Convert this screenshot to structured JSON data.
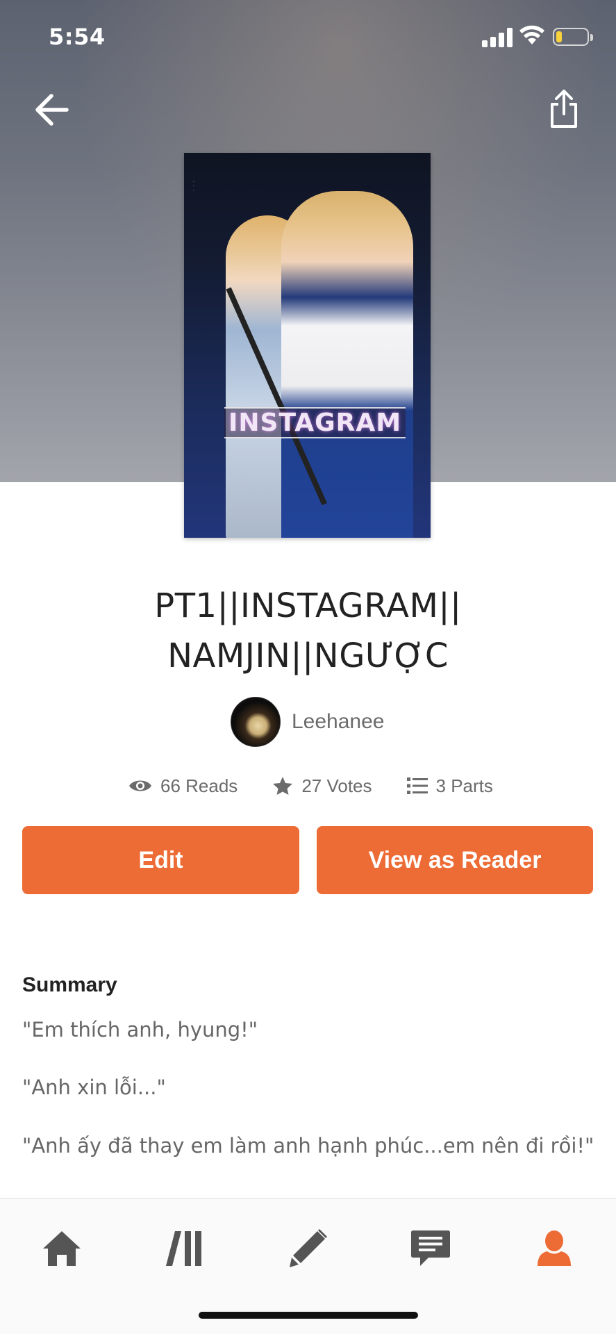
{
  "status_bar": {
    "time": "5:54"
  },
  "cover": {
    "title_text": "INSTAGRAM"
  },
  "story": {
    "title_line1": "PT1||INSTAGRAM||",
    "title_line2": "NAMJIN||NGƯỢC",
    "author": "Leehanee"
  },
  "stats": {
    "reads": "66 Reads",
    "votes": "27 Votes",
    "parts": "3 Parts"
  },
  "actions": {
    "edit_label": "Edit",
    "view_as_reader_label": "View as Reader"
  },
  "summary": {
    "heading": "Summary",
    "lines": [
      "\"Em thích anh, hyung!\"",
      "\"Anh xin lỗi...\"",
      "\"Anh ấy đã thay em làm anh hạnh phúc...em nên đi rồi!\""
    ]
  },
  "colors": {
    "accent": "#ed6b35",
    "active_tab": "#ed6b35",
    "inactive_tab": "#555555",
    "battery_level": "#f7d23c"
  },
  "battery": {
    "level_percent": 20
  },
  "tabs": [
    {
      "name": "home",
      "icon": "home-icon",
      "active": false
    },
    {
      "name": "library",
      "icon": "library-icon",
      "active": false
    },
    {
      "name": "write",
      "icon": "pencil-icon",
      "active": false
    },
    {
      "name": "messages",
      "icon": "chat-icon",
      "active": false
    },
    {
      "name": "profile",
      "icon": "profile-icon",
      "active": true
    }
  ]
}
